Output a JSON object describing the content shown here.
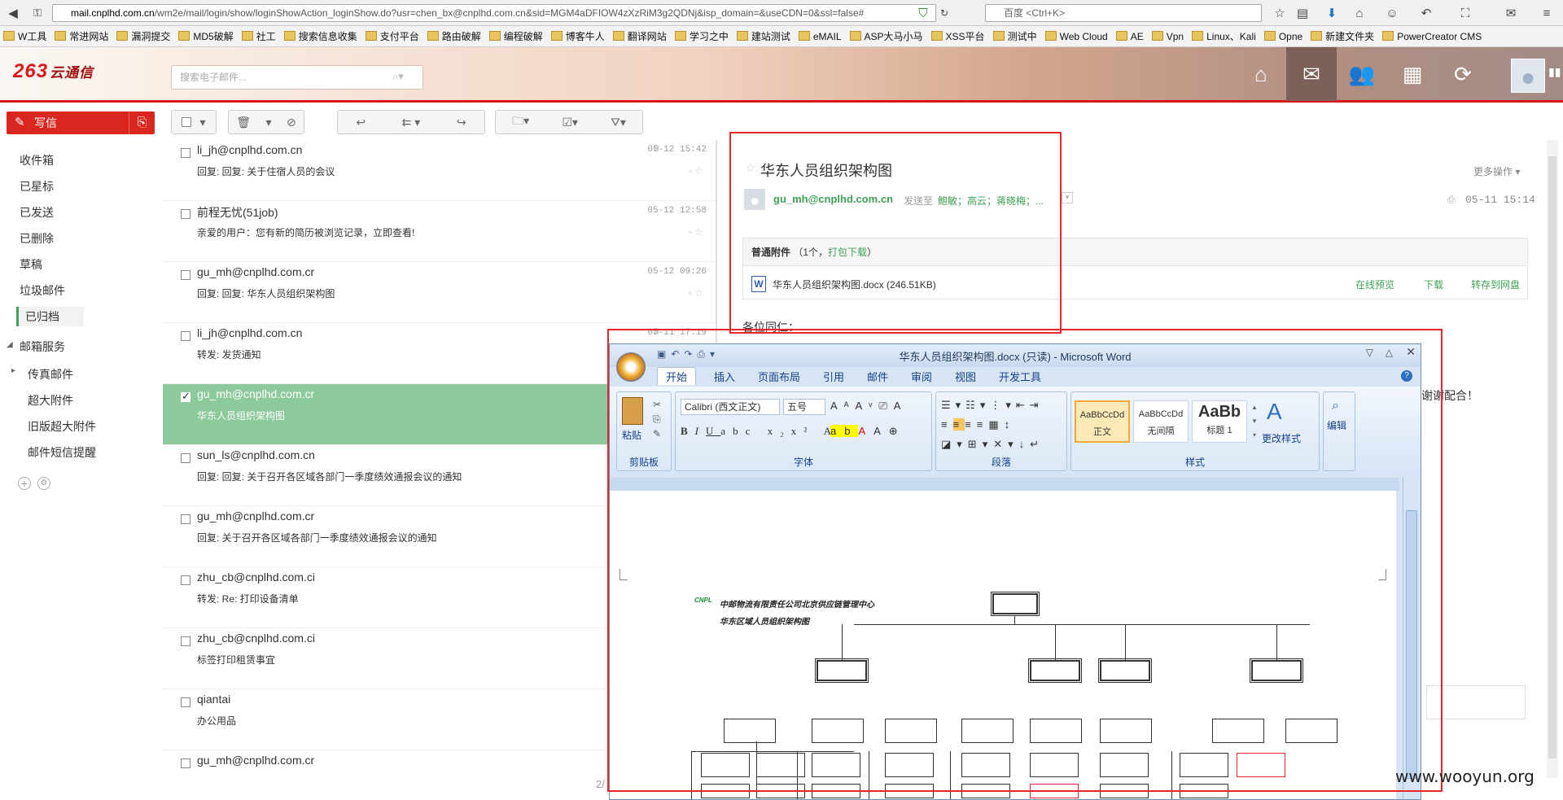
{
  "browser": {
    "url_host": "mail.cnplhd.com.cn",
    "url_path": "/wm2e/mail/login/show/loginShowAction_loginShow.do?usr=chen_bx@cnplhd.com.cn&sid=MGM4aDFIOW4zXzRiM3g2QDNj&isp_domain=&useCDN=0&ssl=false#",
    "search_placeholder": "百度 <Ctrl+K>",
    "bookmarks": [
      "W工具",
      "常进网站",
      "漏洞提交",
      "MD5破解",
      "社工",
      "搜索信息收集",
      "支付平台",
      "路由破解",
      "编程破解",
      "博客牛人",
      "翻译网站",
      "学习之中",
      "建站测试",
      "eMAIL",
      "ASP大马小马",
      "XSS平台",
      "测试中",
      "Web Cloud",
      "AE",
      "Vpn",
      "Linux、Kali",
      "Opne",
      "新建文件夹",
      "PowerCreator CMS"
    ]
  },
  "app": {
    "logo_main": "263",
    "logo_sub": "云通信",
    "search_placeholder": "搜索电子邮件...",
    "top_icons": [
      "home-icon",
      "mail-icon",
      "contacts-icon",
      "calendar-icon",
      "sync-icon",
      "avatar-icon"
    ]
  },
  "sidebar": {
    "compose": "写信",
    "folders": [
      "收件箱",
      "已星标",
      "已发送",
      "已删除",
      "草稿",
      "垃圾邮件",
      "已归档"
    ],
    "services_title": "邮箱服务",
    "services": [
      "传真邮件",
      "超大附件",
      "旧版超大附件",
      "邮件短信提醒"
    ]
  },
  "mail_list": [
    {
      "from": "li_jh@cnplhd.com.cn",
      "subject": "回复: 回复: 关于住宿人员的会议",
      "date": "05-12 15:42",
      "attach": true,
      "selected": false
    },
    {
      "from": "前程无忧(51job)",
      "subject": "亲爱的用户：您有新的简历被浏览记录，立即查看!",
      "date": "05-12 12:58",
      "attach": false,
      "selected": false
    },
    {
      "from": "gu_mh@cnplhd.com.cr",
      "subject": "回复: 回复: 华东人员组织架构图",
      "date": "05-12 09:26",
      "attach": false,
      "selected": false
    },
    {
      "from": "li_jh@cnplhd.com.cn",
      "subject": "转发: 发货通知",
      "date": "05-11 17:19",
      "attach": true,
      "selected": false
    },
    {
      "from": "gu_mh@cnplhd.com.cr",
      "subject": "华东人员组织架构图",
      "date": "",
      "attach": false,
      "selected": true
    },
    {
      "from": "sun_ls@cnplhd.com.cn",
      "subject": "回复: 回复: 关于召开各区域各部门一季度绩效通报会议的通知",
      "date": "",
      "attach": false,
      "selected": false
    },
    {
      "from": "gu_mh@cnplhd.com.cr",
      "subject": "回复: 关于召开各区域各部门一季度绩效通报会议的通知",
      "date": "",
      "attach": false,
      "selected": false
    },
    {
      "from": "zhu_cb@cnplhd.com.ci",
      "subject": "转发: Re: 打印设备清单",
      "date": "",
      "attach": false,
      "selected": false
    },
    {
      "from": "zhu_cb@cnplhd.com.ci",
      "subject": "标签打印租赁事宜",
      "date": "",
      "attach": false,
      "selected": false
    },
    {
      "from": "qiantai",
      "subject": "办公用品",
      "date": "",
      "attach": false,
      "selected": false
    },
    {
      "from": "gu_mh@cnplhd.com.cr",
      "subject": "",
      "date": "",
      "attach": false,
      "selected": false
    }
  ],
  "pager": "2/",
  "reading": {
    "title": "华东人员组织架构图",
    "more": "更多操作",
    "sender": "gu_mh@cnplhd.com.cn",
    "sent_to_label": "发送至",
    "recipients": "鲍敏；高云；蒋晓梅；...",
    "date": "05-11 15:14",
    "attach_header": "普通附件",
    "attach_count": "（1个，",
    "attach_pack": "打包下载",
    "attach_close": "）",
    "file_name": "华东人员组织架构图.docx",
    "file_size": "(246.51KB)",
    "preview": "在线预览",
    "download": "下载",
    "save_disk": "转存到网盘",
    "greeting": "各位同仁：",
    "thanks": "谢谢配合！"
  },
  "word": {
    "title": "华东人员组织架构图.docx (只读) - Microsoft Word",
    "tabs": [
      "开始",
      "插入",
      "页面布局",
      "引用",
      "邮件",
      "审阅",
      "视图",
      "开发工具"
    ],
    "paste": "粘贴",
    "font_name": "Calibri (西文正文)",
    "font_size": "五号",
    "styles": [
      {
        "sample": "AaBbCcDd",
        "name": "正文"
      },
      {
        "sample": "AaBbCcDd",
        "name": "无间隔"
      },
      {
        "sample": "AaBb",
        "name": "标题 1"
      }
    ],
    "change_styles": "更改样式",
    "edit": "编辑",
    "group_labels": [
      "剪贴板",
      "字体",
      "段落",
      "样式"
    ],
    "doc_company": "中邮物流有限责任公司北京供应链管理中心",
    "doc_heading": "华东区域人员组织架构图",
    "doc_logo": "CNPL"
  },
  "watermark": "www.wooyun.org"
}
